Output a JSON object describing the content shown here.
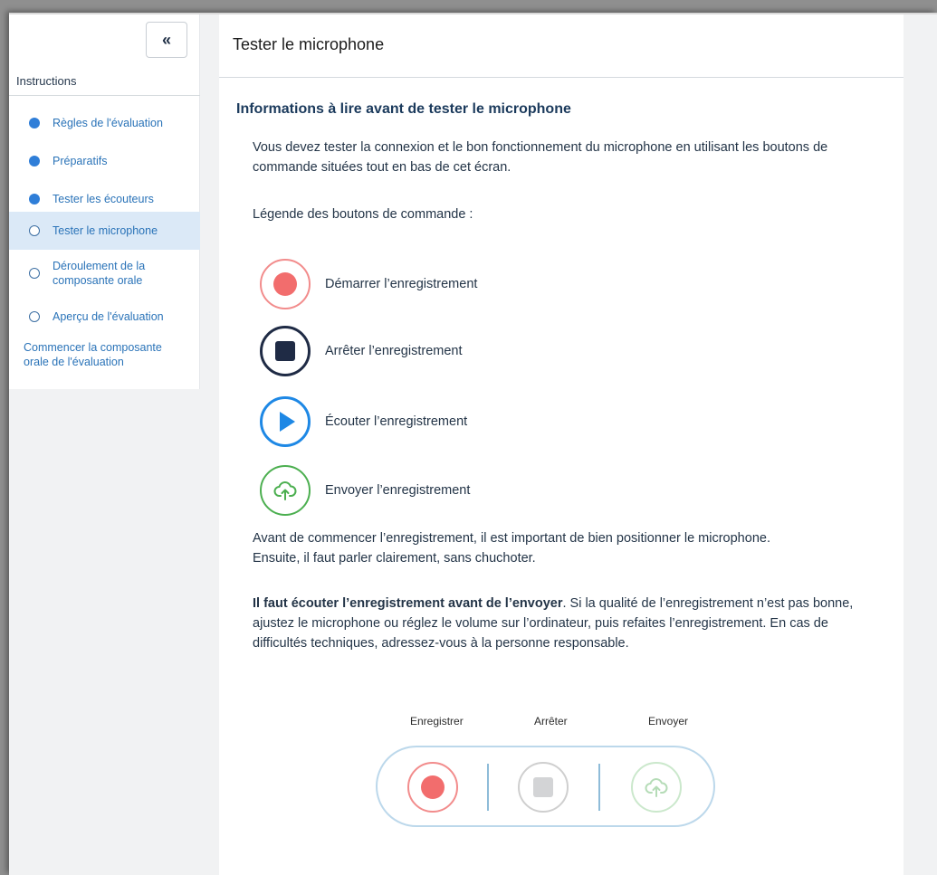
{
  "sidebar": {
    "collapse_label": "«",
    "heading": "Instructions",
    "items": [
      {
        "label": "Règles de l'évaluation",
        "status": "filled"
      },
      {
        "label": "Préparatifs",
        "status": "filled"
      },
      {
        "label": "Tester les écouteurs",
        "status": "filled"
      },
      {
        "label": "Tester le microphone",
        "status": "empty",
        "active": true
      },
      {
        "label": "Déroulement de la composante orale",
        "status": "empty"
      },
      {
        "label": "Aperçu de l'évaluation",
        "status": "empty"
      }
    ],
    "start_link": "Commencer la composante orale de l'évaluation"
  },
  "main": {
    "page_title": "Tester le microphone",
    "section_title": "Informations à lire avant de tester le microphone",
    "intro": "Vous devez tester la connexion et le bon fonctionnement du microphone en utilisant les boutons de commande situées tout en bas de cet écran.",
    "legend_heading": "Légende des boutons de commande :",
    "legend": [
      {
        "label": "Démarrer l’enregistrement",
        "icon": "record-icon"
      },
      {
        "label": "Arrêter l’enregistrement",
        "icon": "stop-icon"
      },
      {
        "label": "Écouter l’enregistrement",
        "icon": "play-icon"
      },
      {
        "label": "Envoyer l’enregistrement",
        "icon": "upload-cloud-icon"
      }
    ],
    "positioning": "Avant de commencer l’enregistrement, il est important de bien positionner le microphone. Ensuite, il faut parler clairement, sans chuchoter.",
    "warning_bold": "Il faut écouter l’enregistrement avant de l’envoyer",
    "warning_rest": ". Si la qualité de l’enregistrement n’est pas bonne, ajustez le microphone ou réglez le volume sur l’ordinateur, puis refaites l’enregistrement. En cas de difficultés techniques, adressez-vous à la personne responsable."
  },
  "controls": {
    "record_label": "Enregistrer",
    "stop_label": "Arrêter",
    "send_label": "Envoyer"
  },
  "colors": {
    "accent_blue": "#2f7ed8",
    "record_red": "#f26d6d",
    "stop_navy": "#1f2b45",
    "play_blue": "#1e88e5",
    "send_green": "#4caf50"
  }
}
